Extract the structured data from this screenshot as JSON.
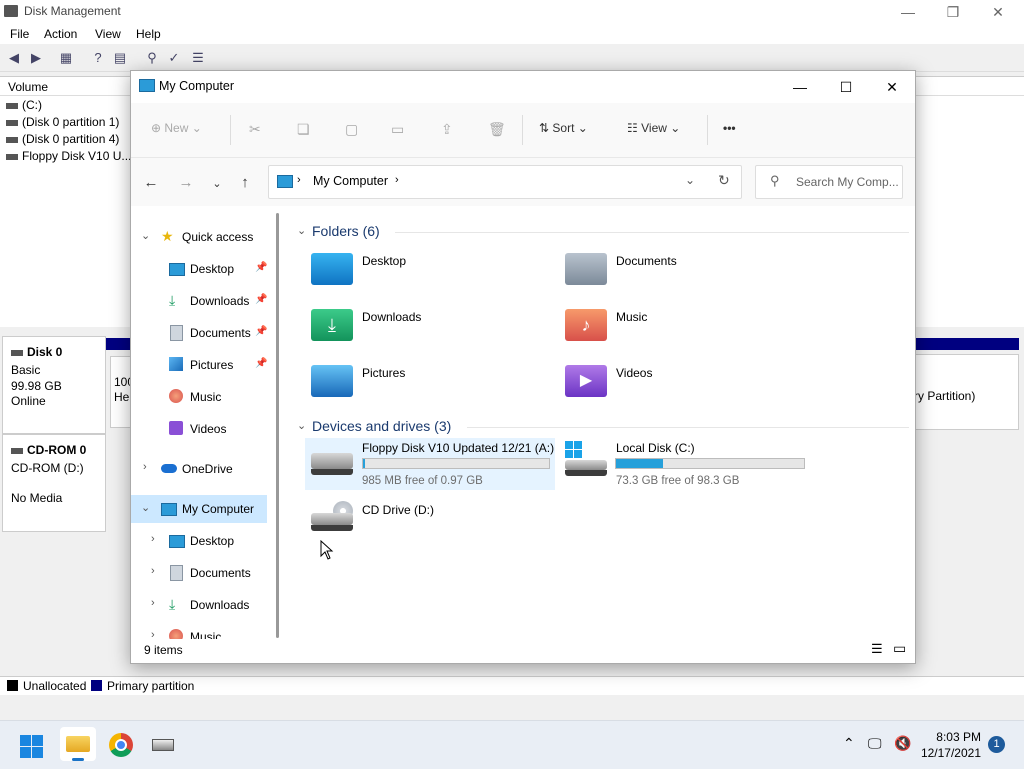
{
  "diskmgmt": {
    "title": "Disk Management",
    "menu": [
      "File",
      "Action",
      "View",
      "Help"
    ],
    "column_volume": "Volume",
    "volumes": [
      "(C:)",
      "(Disk 0 partition 1)",
      "(Disk 0 partition 4)",
      "Floppy Disk V10 U..."
    ],
    "disks": [
      {
        "name": "Disk 0",
        "type": "Basic",
        "size": "99.98 GB",
        "status": "Online"
      },
      {
        "name": "CD-ROM 0",
        "type": "CD-ROM (D:)",
        "size": "",
        "status": "No Media"
      }
    ],
    "partial_left": [
      "100",
      "He"
    ],
    "partial_right": "ry Partition)",
    "legend": [
      {
        "label": "Unallocated",
        "color": "#000000"
      },
      {
        "label": "Primary partition",
        "color": "#000080"
      }
    ]
  },
  "explorer": {
    "title": "My Computer",
    "cmd": {
      "new": "New",
      "sort": "Sort",
      "view": "View",
      "more": "•••"
    },
    "address": "My Computer",
    "search_placeholder": "Search My Comp...",
    "nav": {
      "quick_access": "Quick access",
      "qa_items": [
        "Desktop",
        "Downloads",
        "Documents",
        "Pictures",
        "Music",
        "Videos"
      ],
      "onedrive": "OneDrive",
      "my_computer": "My Computer",
      "mc_items": [
        "Desktop",
        "Documents",
        "Downloads",
        "Music"
      ]
    },
    "folders_header": "Folders (6)",
    "folders": [
      "Desktop",
      "Documents",
      "Downloads",
      "Music",
      "Pictures",
      "Videos"
    ],
    "devices_header": "Devices and drives (3)",
    "drives": [
      {
        "name": "Floppy Disk V10 Updated 12/21 (A:)",
        "free": "985 MB free of 0.97 GB",
        "used_fraction": 0.01
      },
      {
        "name": "Local Disk (C:)",
        "free": "73.3 GB free of 98.3 GB",
        "used_fraction": 0.25
      },
      {
        "name": "CD Drive (D:)"
      }
    ],
    "status": "9 items"
  },
  "taskbar": {
    "time": "8:03 PM",
    "date": "12/17/2021",
    "notifications": "1"
  },
  "colors": {
    "accent": "#26a0da",
    "selection": "#cce8ff",
    "primary_partition": "#000080"
  }
}
